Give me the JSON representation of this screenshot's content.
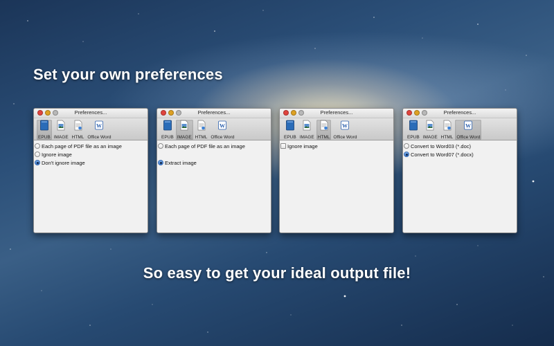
{
  "headline_top": "Set your own preferences",
  "headline_bottom": "So easy to get your ideal output file!",
  "toolbar": [
    "EPUB",
    "IMAGE",
    "HTML",
    "Office Word"
  ],
  "windows": [
    {
      "title": "Preferences...",
      "selected_tab": "EPUB",
      "options": [
        {
          "type": "radio",
          "label": "Each page of PDF file as an image",
          "checked": false
        },
        {
          "type": "radio",
          "label": "Ignore image",
          "checked": false
        },
        {
          "type": "radio",
          "label": "Don't ignore image",
          "checked": true
        }
      ]
    },
    {
      "title": "Preferences...",
      "selected_tab": "IMAGE",
      "options": [
        {
          "type": "radio",
          "label": "Each page of PDF file as an image",
          "checked": false
        },
        {
          "type": "radio",
          "label": "Extract image",
          "checked": true
        }
      ]
    },
    {
      "title": "Preferences...",
      "selected_tab": "HTML",
      "options": [
        {
          "type": "checkbox",
          "label": "Ignore image",
          "checked": false
        }
      ]
    },
    {
      "title": "Preferences...",
      "selected_tab": "Office Word",
      "options": [
        {
          "type": "radio",
          "label": "Convert to Word03 (*.doc)",
          "checked": false
        },
        {
          "type": "radio",
          "label": "Convert to Word07 (*.docx)",
          "checked": true
        }
      ]
    }
  ],
  "icons": {
    "EPUB": "epub-book-icon",
    "IMAGE": "image-file-icon",
    "HTML": "html-file-icon",
    "Office Word": "office-word-icon"
  },
  "colors": {
    "epub": "#2a6cb8",
    "image": "#5a8fcf",
    "word": "#2b5fad",
    "radio_selected": "#3a76c9"
  }
}
